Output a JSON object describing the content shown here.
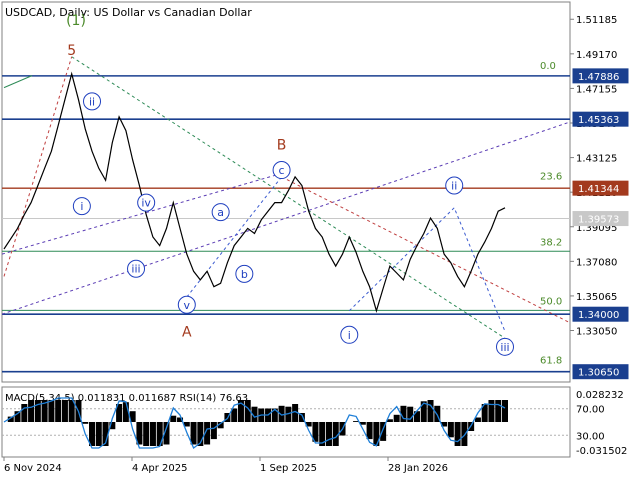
{
  "header": {
    "symbol": "USDCAD",
    "timeframe": "Daily",
    "description": "US Dollar vs Canadian Dollar"
  },
  "colors": {
    "background": "#ffffff",
    "price_line": "#000000",
    "wave_label": "#1f3fbf",
    "level_line": "#1a3f8f",
    "red_level": "#a33a1e",
    "green_label": "#4b8a2a",
    "green_line": "#2e8b57",
    "red_dash": "#c04040",
    "purple_dash": "#5a3cb4",
    "blue_dash": "#3b5bd0",
    "grid": "#c8c8c8",
    "macd_line": "#1e7fd8",
    "macd_hist": "#000000",
    "current_price_tag": "#c8c8c8"
  },
  "chart_data": {
    "type": "line",
    "title": "USDCAD, Daily:  US Dollar vs Canadian Dollar",
    "x_labels": [
      "6 Nov 2024",
      "4 Apr 2025",
      "1 Sep 2025",
      "28 Jan 2026"
    ],
    "y_ticks": [
      "1.51185",
      "1.49170",
      "1.47155",
      "1.45140",
      "1.43125",
      "1.41110",
      "1.39095",
      "1.37080",
      "1.35065",
      "1.33050"
    ],
    "y_range": [
      1.3005,
      1.5219
    ],
    "price_series": [
      1.378,
      1.384,
      1.39,
      1.398,
      1.405,
      1.415,
      1.425,
      1.435,
      1.45,
      1.465,
      1.48,
      1.465,
      1.448,
      1.435,
      1.425,
      1.418,
      1.44,
      1.455,
      1.447,
      1.43,
      1.415,
      1.398,
      1.385,
      1.38,
      1.39,
      1.405,
      1.39,
      1.375,
      1.365,
      1.36,
      1.365,
      1.356,
      1.358,
      1.37,
      1.38,
      1.385,
      1.39,
      1.387,
      1.395,
      1.4,
      1.405,
      1.405,
      1.412,
      1.42,
      1.415,
      1.4,
      1.39,
      1.385,
      1.375,
      1.368,
      1.375,
      1.385,
      1.376,
      1.365,
      1.356,
      1.342,
      1.355,
      1.368,
      1.364,
      1.36,
      1.372,
      1.38,
      1.387,
      1.396,
      1.39,
      1.375,
      1.37,
      1.362,
      1.356,
      1.365,
      1.375,
      1.382,
      1.39,
      1.4,
      1.402
    ],
    "price_labels": [
      {
        "value": 1.47886,
        "text": "1.47886",
        "style": "box"
      },
      {
        "value": 1.45363,
        "text": "1.45363",
        "style": "box"
      },
      {
        "value": 1.41344,
        "text": "1.41344",
        "style": "red"
      },
      {
        "value": 1.39573,
        "text": "1.39573",
        "style": "current"
      },
      {
        "value": 1.34,
        "text": "1.34000",
        "style": "box"
      },
      {
        "value": 1.3065,
        "text": "1.30650",
        "style": "box"
      }
    ],
    "fib_labels": [
      {
        "text": "0.0",
        "value": 1.481
      },
      {
        "text": "23.6",
        "value": 1.4168
      },
      {
        "text": "38.2",
        "value": 1.3784
      },
      {
        "text": "50.0",
        "value": 1.344
      },
      {
        "text": "61.8",
        "value": 1.3095
      }
    ],
    "wave_labels": [
      {
        "text": "(1)",
        "style": "green-text",
        "x": 0,
        "y": 1.5085
      },
      {
        "text": "5",
        "style": "red-text",
        "x": 10,
        "y": 1.491
      },
      {
        "text": "i",
        "style": "circle",
        "x": 11.5,
        "y": 1.403
      },
      {
        "text": "ii",
        "style": "circle",
        "x": 13,
        "y": 1.464
      },
      {
        "text": "iv",
        "style": "circle",
        "x": 21,
        "y": 1.405
      },
      {
        "text": "iii",
        "style": "circle",
        "x": 19.5,
        "y": 1.3665
      },
      {
        "text": "v",
        "style": "circle",
        "x": 27,
        "y": 1.3455
      },
      {
        "text": "a",
        "style": "circle",
        "x": 32,
        "y": 1.3995
      },
      {
        "text": "b",
        "style": "circle",
        "x": 35.5,
        "y": 1.3635
      },
      {
        "text": "c",
        "style": "circle",
        "x": 41,
        "y": 1.424
      },
      {
        "text": "B",
        "style": "red-text",
        "x": 41,
        "y": 1.436
      },
      {
        "text": "A",
        "style": "red-text",
        "x": 27,
        "y": 1.327
      },
      {
        "text": "i",
        "style": "circle",
        "x": 51,
        "y": 1.328
      },
      {
        "text": "ii",
        "style": "circle",
        "x": 66.5,
        "y": 1.415
      },
      {
        "text": "iii",
        "style": "circle",
        "x": 74,
        "y": 1.321
      }
    ],
    "indicator": {
      "name": "MACD(5,34,5)",
      "macd_value": "0.011831",
      "signal_value": "0.011687",
      "rsi_name": "RSI(14)",
      "rsi_value": "76.63",
      "y_ticks": [
        "0.028232",
        "70.00",
        "30.00",
        "-0.031502"
      ]
    }
  }
}
